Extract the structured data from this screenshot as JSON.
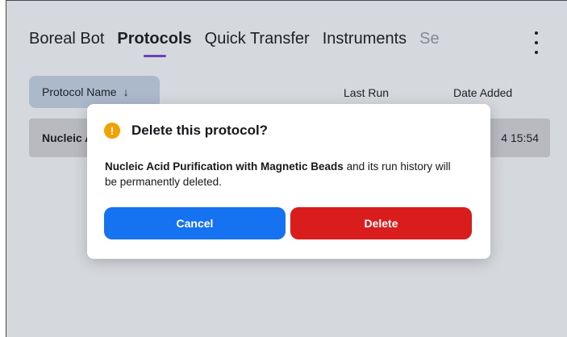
{
  "nav": {
    "tabs": [
      "Boreal Bot",
      "Protocols",
      "Quick Transfer",
      "Instruments",
      "Se"
    ],
    "active_index": 1
  },
  "table": {
    "sort_label": "Protocol Name",
    "sort_icon": "↓",
    "columns": [
      "Last Run",
      "Date Added"
    ],
    "row": {
      "name": "Nucleic Acid Purification with Magnetic Beads",
      "date_added": "4 15:54"
    }
  },
  "modal": {
    "title": "Delete this protocol?",
    "icon": "!",
    "body_bold": "Nucleic Acid Purification with Magnetic Beads",
    "body_rest": " and its run history will be permanently deleted.",
    "cancel_label": "Cancel",
    "delete_label": "Delete"
  },
  "colors": {
    "accent": "#6a3ec8",
    "cancel": "#1572f0",
    "delete": "#d91c1c",
    "warning": "#f2a200"
  }
}
